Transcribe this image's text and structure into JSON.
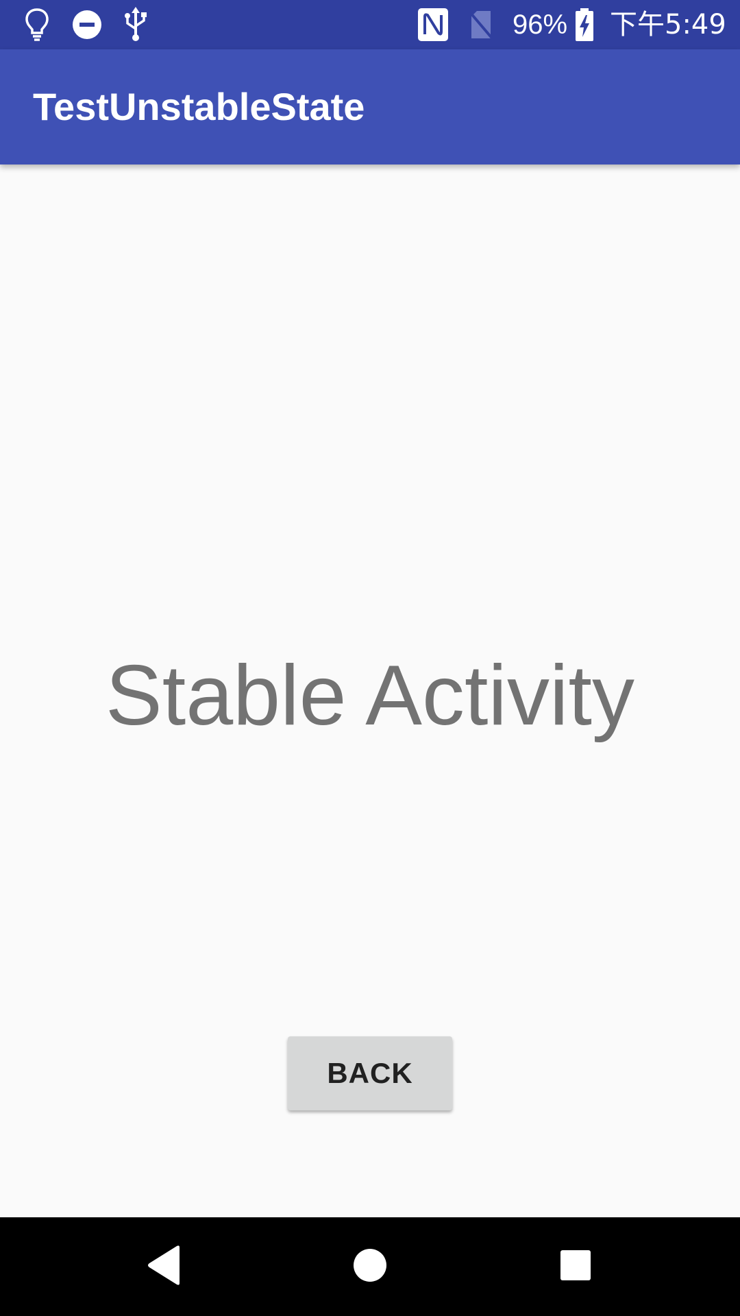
{
  "status_bar": {
    "battery_percent": "96%",
    "time": "下午5:49",
    "icons": [
      "lightbulb-icon",
      "do-not-disturb-icon",
      "usb-icon",
      "nfc-icon",
      "no-sim-icon",
      "battery-charging-icon"
    ]
  },
  "app_bar": {
    "title": "TestUnstableState"
  },
  "main": {
    "heading": "Stable Activity",
    "back_button_label": "BACK"
  },
  "nav_bar": {
    "icons": [
      "back-triangle-icon",
      "home-circle-icon",
      "recents-square-icon"
    ]
  },
  "colors": {
    "status_bar": "#303f9f",
    "app_bar": "#3f51b5",
    "background": "#fafafa",
    "button": "#d6d7d7",
    "heading_text": "#737373"
  }
}
